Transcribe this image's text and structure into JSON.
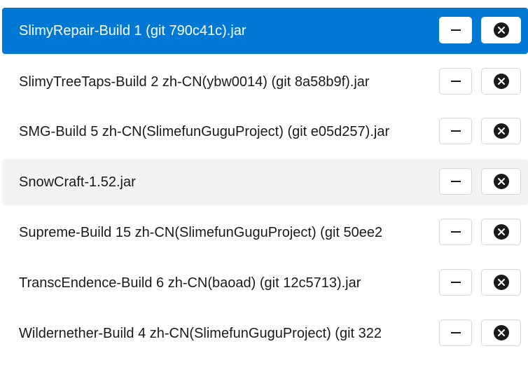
{
  "plugins": [
    {
      "name": "SlimyRepair-Build 1 (git 790c41c).jar",
      "state": "selected"
    },
    {
      "name": "SlimyTreeTaps-Build 2 zh-CN(ybw0014) (git 8a58b9f).jar",
      "state": "normal"
    },
    {
      "name": "SMG-Build 5 zh-CN(SlimefunGuguProject) (git e05d257).jar",
      "state": "normal"
    },
    {
      "name": "SnowCraft-1.52.jar",
      "state": "hover"
    },
    {
      "name": "Supreme-Build 15 zh-CN(SlimefunGuguProject) (git 50ee2",
      "state": "normal"
    },
    {
      "name": "TranscEndence-Build 6 zh-CN(baoad) (git 12c5713).jar",
      "state": "normal"
    },
    {
      "name": "Wildernether-Build 4 zh-CN(SlimefunGuguProject) (git 322",
      "state": "normal"
    }
  ],
  "icons": {
    "remove": "minus-icon",
    "delete": "close-circle-icon"
  },
  "colors": {
    "accent": "#0078d4",
    "hover": "#f3f3f3",
    "text": "#1a1a1a"
  }
}
